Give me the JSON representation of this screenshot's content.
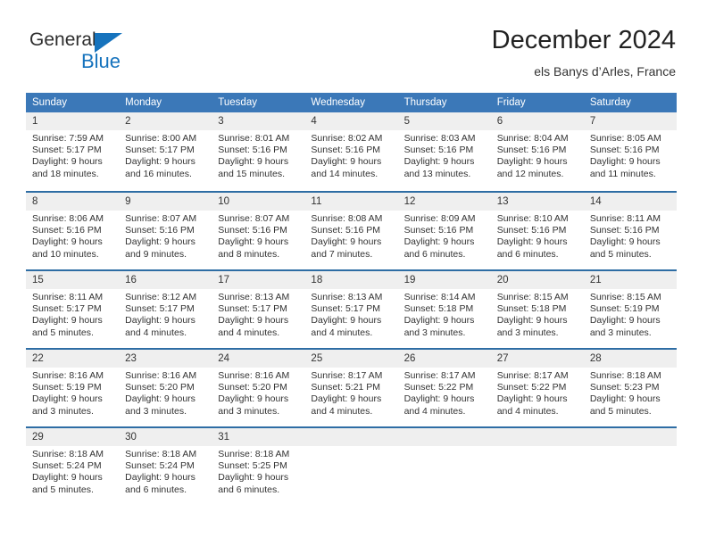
{
  "logo": {
    "word_one": "General",
    "word_two": "Blue",
    "triangle_icon": "logo-triangle-icon"
  },
  "header": {
    "title": "December 2024",
    "subtitle": "els Banys d’Arles, France"
  },
  "colors": {
    "header_blue": "#3b78b8",
    "row_separator_blue": "#2e6da4",
    "daynum_band": "#efefef",
    "logo_blue": "#1673bd",
    "text": "#333333"
  },
  "weekday_headers": [
    "Sunday",
    "Monday",
    "Tuesday",
    "Wednesday",
    "Thursday",
    "Friday",
    "Saturday"
  ],
  "weeks": [
    [
      {
        "day": "1",
        "sunrise": "Sunrise: 7:59 AM",
        "sunset": "Sunset: 5:17 PM",
        "daylight_line1": "Daylight: 9 hours",
        "daylight_line2": "and 18 minutes."
      },
      {
        "day": "2",
        "sunrise": "Sunrise: 8:00 AM",
        "sunset": "Sunset: 5:17 PM",
        "daylight_line1": "Daylight: 9 hours",
        "daylight_line2": "and 16 minutes."
      },
      {
        "day": "3",
        "sunrise": "Sunrise: 8:01 AM",
        "sunset": "Sunset: 5:16 PM",
        "daylight_line1": "Daylight: 9 hours",
        "daylight_line2": "and 15 minutes."
      },
      {
        "day": "4",
        "sunrise": "Sunrise: 8:02 AM",
        "sunset": "Sunset: 5:16 PM",
        "daylight_line1": "Daylight: 9 hours",
        "daylight_line2": "and 14 minutes."
      },
      {
        "day": "5",
        "sunrise": "Sunrise: 8:03 AM",
        "sunset": "Sunset: 5:16 PM",
        "daylight_line1": "Daylight: 9 hours",
        "daylight_line2": "and 13 minutes."
      },
      {
        "day": "6",
        "sunrise": "Sunrise: 8:04 AM",
        "sunset": "Sunset: 5:16 PM",
        "daylight_line1": "Daylight: 9 hours",
        "daylight_line2": "and 12 minutes."
      },
      {
        "day": "7",
        "sunrise": "Sunrise: 8:05 AM",
        "sunset": "Sunset: 5:16 PM",
        "daylight_line1": "Daylight: 9 hours",
        "daylight_line2": "and 11 minutes."
      }
    ],
    [
      {
        "day": "8",
        "sunrise": "Sunrise: 8:06 AM",
        "sunset": "Sunset: 5:16 PM",
        "daylight_line1": "Daylight: 9 hours",
        "daylight_line2": "and 10 minutes."
      },
      {
        "day": "9",
        "sunrise": "Sunrise: 8:07 AM",
        "sunset": "Sunset: 5:16 PM",
        "daylight_line1": "Daylight: 9 hours",
        "daylight_line2": "and 9 minutes."
      },
      {
        "day": "10",
        "sunrise": "Sunrise: 8:07 AM",
        "sunset": "Sunset: 5:16 PM",
        "daylight_line1": "Daylight: 9 hours",
        "daylight_line2": "and 8 minutes."
      },
      {
        "day": "11",
        "sunrise": "Sunrise: 8:08 AM",
        "sunset": "Sunset: 5:16 PM",
        "daylight_line1": "Daylight: 9 hours",
        "daylight_line2": "and 7 minutes."
      },
      {
        "day": "12",
        "sunrise": "Sunrise: 8:09 AM",
        "sunset": "Sunset: 5:16 PM",
        "daylight_line1": "Daylight: 9 hours",
        "daylight_line2": "and 6 minutes."
      },
      {
        "day": "13",
        "sunrise": "Sunrise: 8:10 AM",
        "sunset": "Sunset: 5:16 PM",
        "daylight_line1": "Daylight: 9 hours",
        "daylight_line2": "and 6 minutes."
      },
      {
        "day": "14",
        "sunrise": "Sunrise: 8:11 AM",
        "sunset": "Sunset: 5:16 PM",
        "daylight_line1": "Daylight: 9 hours",
        "daylight_line2": "and 5 minutes."
      }
    ],
    [
      {
        "day": "15",
        "sunrise": "Sunrise: 8:11 AM",
        "sunset": "Sunset: 5:17 PM",
        "daylight_line1": "Daylight: 9 hours",
        "daylight_line2": "and 5 minutes."
      },
      {
        "day": "16",
        "sunrise": "Sunrise: 8:12 AM",
        "sunset": "Sunset: 5:17 PM",
        "daylight_line1": "Daylight: 9 hours",
        "daylight_line2": "and 4 minutes."
      },
      {
        "day": "17",
        "sunrise": "Sunrise: 8:13 AM",
        "sunset": "Sunset: 5:17 PM",
        "daylight_line1": "Daylight: 9 hours",
        "daylight_line2": "and 4 minutes."
      },
      {
        "day": "18",
        "sunrise": "Sunrise: 8:13 AM",
        "sunset": "Sunset: 5:17 PM",
        "daylight_line1": "Daylight: 9 hours",
        "daylight_line2": "and 4 minutes."
      },
      {
        "day": "19",
        "sunrise": "Sunrise: 8:14 AM",
        "sunset": "Sunset: 5:18 PM",
        "daylight_line1": "Daylight: 9 hours",
        "daylight_line2": "and 3 minutes."
      },
      {
        "day": "20",
        "sunrise": "Sunrise: 8:15 AM",
        "sunset": "Sunset: 5:18 PM",
        "daylight_line1": "Daylight: 9 hours",
        "daylight_line2": "and 3 minutes."
      },
      {
        "day": "21",
        "sunrise": "Sunrise: 8:15 AM",
        "sunset": "Sunset: 5:19 PM",
        "daylight_line1": "Daylight: 9 hours",
        "daylight_line2": "and 3 minutes."
      }
    ],
    [
      {
        "day": "22",
        "sunrise": "Sunrise: 8:16 AM",
        "sunset": "Sunset: 5:19 PM",
        "daylight_line1": "Daylight: 9 hours",
        "daylight_line2": "and 3 minutes."
      },
      {
        "day": "23",
        "sunrise": "Sunrise: 8:16 AM",
        "sunset": "Sunset: 5:20 PM",
        "daylight_line1": "Daylight: 9 hours",
        "daylight_line2": "and 3 minutes."
      },
      {
        "day": "24",
        "sunrise": "Sunrise: 8:16 AM",
        "sunset": "Sunset: 5:20 PM",
        "daylight_line1": "Daylight: 9 hours",
        "daylight_line2": "and 3 minutes."
      },
      {
        "day": "25",
        "sunrise": "Sunrise: 8:17 AM",
        "sunset": "Sunset: 5:21 PM",
        "daylight_line1": "Daylight: 9 hours",
        "daylight_line2": "and 4 minutes."
      },
      {
        "day": "26",
        "sunrise": "Sunrise: 8:17 AM",
        "sunset": "Sunset: 5:22 PM",
        "daylight_line1": "Daylight: 9 hours",
        "daylight_line2": "and 4 minutes."
      },
      {
        "day": "27",
        "sunrise": "Sunrise: 8:17 AM",
        "sunset": "Sunset: 5:22 PM",
        "daylight_line1": "Daylight: 9 hours",
        "daylight_line2": "and 4 minutes."
      },
      {
        "day": "28",
        "sunrise": "Sunrise: 8:18 AM",
        "sunset": "Sunset: 5:23 PM",
        "daylight_line1": "Daylight: 9 hours",
        "daylight_line2": "and 5 minutes."
      }
    ],
    [
      {
        "day": "29",
        "sunrise": "Sunrise: 8:18 AM",
        "sunset": "Sunset: 5:24 PM",
        "daylight_line1": "Daylight: 9 hours",
        "daylight_line2": "and 5 minutes."
      },
      {
        "day": "30",
        "sunrise": "Sunrise: 8:18 AM",
        "sunset": "Sunset: 5:24 PM",
        "daylight_line1": "Daylight: 9 hours",
        "daylight_line2": "and 6 minutes."
      },
      {
        "day": "31",
        "sunrise": "Sunrise: 8:18 AM",
        "sunset": "Sunset: 5:25 PM",
        "daylight_line1": "Daylight: 9 hours",
        "daylight_line2": "and 6 minutes."
      },
      {
        "day": "",
        "sunrise": "",
        "sunset": "",
        "daylight_line1": "",
        "daylight_line2": ""
      },
      {
        "day": "",
        "sunrise": "",
        "sunset": "",
        "daylight_line1": "",
        "daylight_line2": ""
      },
      {
        "day": "",
        "sunrise": "",
        "sunset": "",
        "daylight_line1": "",
        "daylight_line2": ""
      },
      {
        "day": "",
        "sunrise": "",
        "sunset": "",
        "daylight_line1": "",
        "daylight_line2": ""
      }
    ]
  ]
}
